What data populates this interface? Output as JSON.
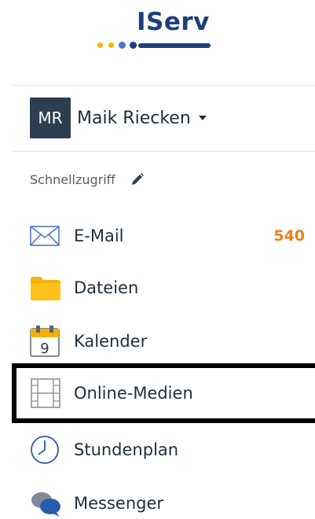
{
  "logo": {
    "text": "IServ"
  },
  "user": {
    "initials": "MR",
    "name": "Maik Riecken"
  },
  "quick_access": {
    "label": "Schnellzugriff"
  },
  "items": [
    {
      "label": "E-Mail",
      "icon": "envelope-icon",
      "badge": "540"
    },
    {
      "label": "Dateien",
      "icon": "folder-icon"
    },
    {
      "label": "Kalender",
      "icon": "calendar-icon",
      "day": "9"
    },
    {
      "label": "Online-Medien",
      "icon": "film-icon",
      "highlighted": true
    },
    {
      "label": "Stundenplan",
      "icon": "clock-icon"
    },
    {
      "label": "Messenger",
      "icon": "chat-bubbles-icon"
    }
  ],
  "colors": {
    "brand": "#1d3f7e",
    "accent_yellow": "#f2b705",
    "badge": "#f07d14",
    "avatar_bg": "#2c3e50"
  }
}
